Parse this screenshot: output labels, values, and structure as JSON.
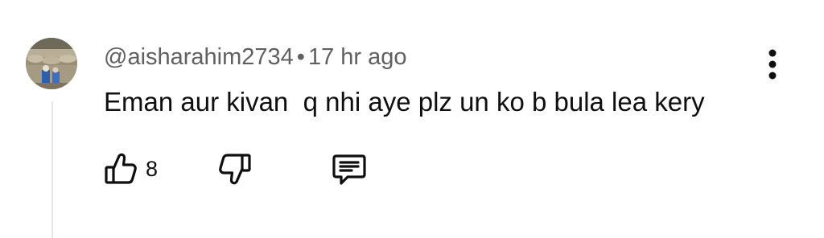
{
  "comment": {
    "author_handle": "@aisharahim2734",
    "separator": "•",
    "timestamp": "17 hr ago",
    "text": "Eman aur kivan  q nhi aye plz un ko b bula lea kery",
    "likes": "8"
  },
  "icons": {
    "avatar": "avatar-photo",
    "menu": "more-vert-icon",
    "like": "thumbs-up-icon",
    "dislike": "thumbs-down-icon",
    "reply": "comment-reply-icon"
  },
  "colors": {
    "meta_text": "#606060",
    "body_text": "#0f0f0f",
    "thread_line": "#e6e6e6"
  }
}
